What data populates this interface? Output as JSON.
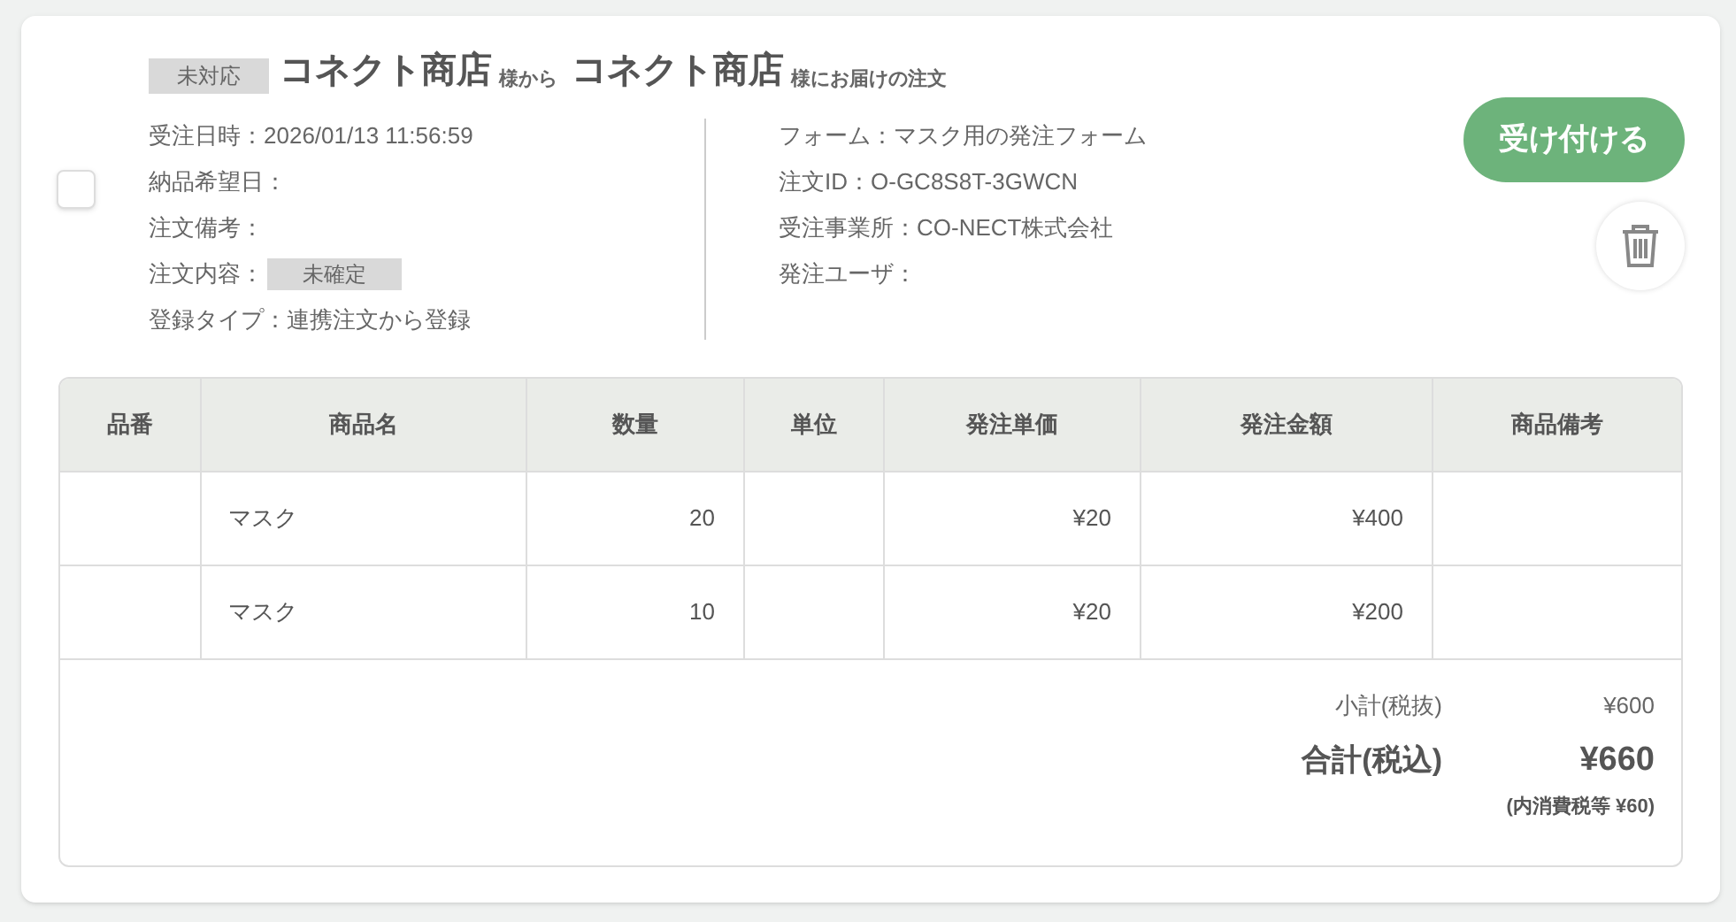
{
  "order": {
    "status": "未対応",
    "from_shop": "コネクト商店",
    "from_suffix": "様から",
    "to_shop": "コネクト商店",
    "to_suffix": "様にお届けの注文",
    "checked": false,
    "left_fields": [
      {
        "text": "受注日時：2026/01/13 11:56:59"
      },
      {
        "text": "納品希望日："
      },
      {
        "text": "注文備考："
      },
      {
        "text": "注文内容：",
        "badge": "未確定"
      },
      {
        "text": "登録タイプ：連携注文から登録"
      }
    ],
    "right_fields": [
      {
        "text": "フォーム：マスク用の発注フォーム"
      },
      {
        "text": "注文ID：O-GC8S8T-3GWCN"
      },
      {
        "text": "受注事業所：CO-NECT株式会社"
      },
      {
        "text": "発注ユーザ："
      }
    ],
    "accept_button": "受け付ける"
  },
  "table": {
    "columns": [
      "品番",
      "商品名",
      "数量",
      "単位",
      "発注単価",
      "発注金額",
      "商品備考"
    ],
    "rows": [
      [
        "",
        "マスク",
        "20",
        "",
        "¥20",
        "¥400",
        ""
      ],
      [
        "",
        "マスク",
        "10",
        "",
        "¥20",
        "¥200",
        ""
      ]
    ]
  },
  "totals": {
    "subtotal_label": "小計(税抜)",
    "subtotal": "¥600",
    "total_label": "合計(税込)",
    "total": "¥660",
    "tax_note": "(内消費税等 ¥60)"
  }
}
